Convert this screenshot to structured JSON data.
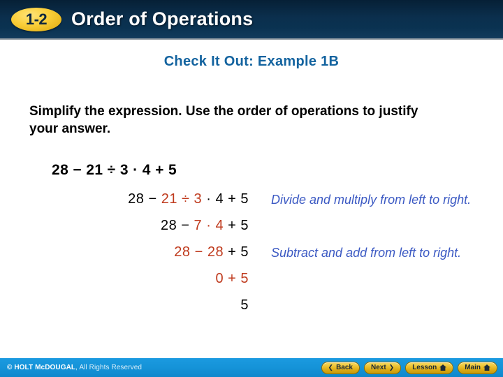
{
  "header": {
    "badge": "1-2",
    "title": "Order of Operations"
  },
  "slide": {
    "subtitle": "Check It Out: Example 1B",
    "instructions": "Simplify the expression. Use the order of operations to justify your answer.",
    "main_expression": "28 − 21 ÷ 3 · 4 + 5",
    "steps": [
      {
        "pre": "28 − ",
        "highlight": "21 ÷ 3",
        "post": " · 4 + 5"
      },
      {
        "pre": "28 − ",
        "highlight": "7 · 4",
        "post": " + 5"
      },
      {
        "pre": "",
        "highlight": "28 − 28",
        "post": " + 5"
      },
      {
        "pre": "",
        "highlight": "0 + 5",
        "post": ""
      },
      {
        "pre": "5",
        "highlight": "",
        "post": ""
      }
    ],
    "notes": [
      "Divide and multiply from left to right.",
      "Subtract and add from left to right."
    ]
  },
  "footer": {
    "copyright_brand": "© HOLT McDOUGAL",
    "copyright_rest": ", All Rights Reserved",
    "buttons": [
      {
        "label": "Back",
        "icon": "chevron-left-icon",
        "glyph": "❮",
        "icon_side": "left"
      },
      {
        "label": "Next",
        "icon": "chevron-right-icon",
        "glyph": "❯",
        "icon_side": "right"
      },
      {
        "label": "Lesson",
        "icon": "home-icon",
        "glyph": "home",
        "icon_side": "right"
      },
      {
        "label": "Main",
        "icon": "home-icon",
        "glyph": "home",
        "icon_side": "right"
      }
    ]
  },
  "colors": {
    "header_bg": "#0b2f4d",
    "badge_gold": "#ecc02c",
    "subtitle_blue": "#13639f",
    "highlight_red": "#bf3a1d",
    "note_blue": "#3b59c3",
    "footer_blue": "#1593d8"
  }
}
